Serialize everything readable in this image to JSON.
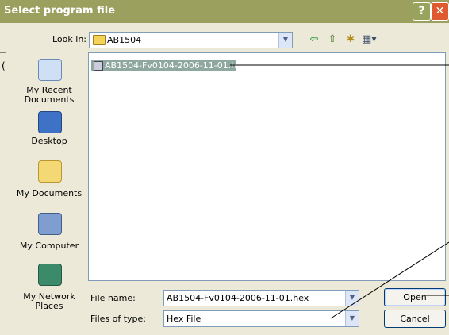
{
  "title": "Select program file",
  "title_buttons": {
    "help": "?",
    "close": "✕"
  },
  "look_in": {
    "label": "Look in:",
    "value": "AB1504"
  },
  "toolbar_icons": [
    "back-icon",
    "up-folder-icon",
    "new-folder-icon",
    "views-menu-icon"
  ],
  "places": [
    {
      "label": "My Recent Documents",
      "icon": "recent-documents-icon"
    },
    {
      "label": "Desktop",
      "icon": "desktop-icon"
    },
    {
      "label": "My Documents",
      "icon": "my-documents-icon"
    },
    {
      "label": "My Computer",
      "icon": "my-computer-icon"
    },
    {
      "label": "My Network Places",
      "icon": "network-places-icon"
    }
  ],
  "files": [
    {
      "name": "AB1504-Fv0104-2006-11-01.hex",
      "selected": true
    }
  ],
  "file_name": {
    "label": "File name:",
    "value": "AB1504-Fv0104-2006-11-01.hex"
  },
  "file_type": {
    "label": "Files of type:",
    "value": "Hex File"
  },
  "buttons": {
    "open": "Open",
    "cancel": "Cancel"
  },
  "left_fragment": "(",
  "colors": {
    "titlebar": "#9ba05f",
    "dialog_bg": "#ece9d8",
    "selection": "#8fa89f",
    "close": "#e05a2f"
  }
}
